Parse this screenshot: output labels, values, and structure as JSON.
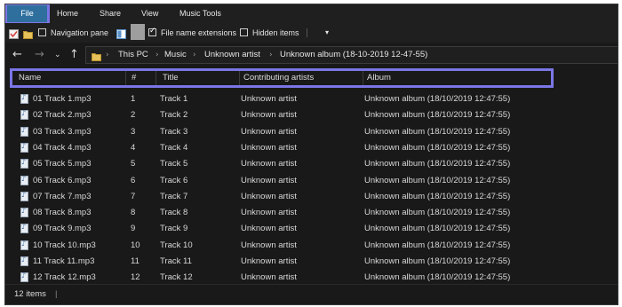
{
  "ribbon": {
    "tabs": [
      "File",
      "Home",
      "Share",
      "View",
      "Music Tools"
    ]
  },
  "view_options": {
    "navigation_pane": "Navigation pane",
    "file_name_extensions": "File name extensions",
    "file_name_extensions_checked": true,
    "hidden_items": "Hidden items",
    "hidden_items_checked": false,
    "dropdown_glyph": "▾"
  },
  "address": {
    "crumbs": [
      "This PC",
      "Music",
      "Unknown artist",
      "Unknown album (18-10-2019 12-47-55)"
    ]
  },
  "columns": [
    "Name",
    "#",
    "Title",
    "Contributing artists",
    "Album"
  ],
  "rows": [
    {
      "name": "01 Track 1.mp3",
      "num": "1",
      "title": "Track 1",
      "artist": "Unknown artist",
      "album": "Unknown album (18/10/2019 12:47:55)"
    },
    {
      "name": "02 Track 2.mp3",
      "num": "2",
      "title": "Track 2",
      "artist": "Unknown artist",
      "album": "Unknown album (18/10/2019 12:47:55)"
    },
    {
      "name": "03 Track 3.mp3",
      "num": "3",
      "title": "Track 3",
      "artist": "Unknown artist",
      "album": "Unknown album (18/10/2019 12:47:55)"
    },
    {
      "name": "04 Track 4.mp3",
      "num": "4",
      "title": "Track 4",
      "artist": "Unknown artist",
      "album": "Unknown album (18/10/2019 12:47:55)"
    },
    {
      "name": "05 Track 5.mp3",
      "num": "5",
      "title": "Track 5",
      "artist": "Unknown artist",
      "album": "Unknown album (18/10/2019 12:47:55)"
    },
    {
      "name": "06 Track 6.mp3",
      "num": "6",
      "title": "Track 6",
      "artist": "Unknown artist",
      "album": "Unknown album (18/10/2019 12:47:55)"
    },
    {
      "name": "07 Track 7.mp3",
      "num": "7",
      "title": "Track 7",
      "artist": "Unknown artist",
      "album": "Unknown album (18/10/2019 12:47:55)"
    },
    {
      "name": "08 Track 8.mp3",
      "num": "8",
      "title": "Track 8",
      "artist": "Unknown artist",
      "album": "Unknown album (18/10/2019 12:47:55)"
    },
    {
      "name": "09 Track 9.mp3",
      "num": "9",
      "title": "Track 9",
      "artist": "Unknown artist",
      "album": "Unknown album (18/10/2019 12:47:55)"
    },
    {
      "name": "10 Track 10.mp3",
      "num": "10",
      "title": "Track 10",
      "artist": "Unknown artist",
      "album": "Unknown album (18/10/2019 12:47:55)"
    },
    {
      "name": "11 Track 11.mp3",
      "num": "11",
      "title": "Track 11",
      "artist": "Unknown artist",
      "album": "Unknown album (18/10/2019 12:47:55)"
    },
    {
      "name": "12 Track 12.mp3",
      "num": "12",
      "title": "Track 12",
      "artist": "Unknown artist",
      "album": "Unknown album (18/10/2019 12:47:55)"
    }
  ],
  "status": {
    "item_count": "12 items",
    "separator": "|"
  },
  "colors": {
    "highlight": "#7b76e6",
    "file_tab": "#2e6f9e",
    "background": "#191919"
  }
}
